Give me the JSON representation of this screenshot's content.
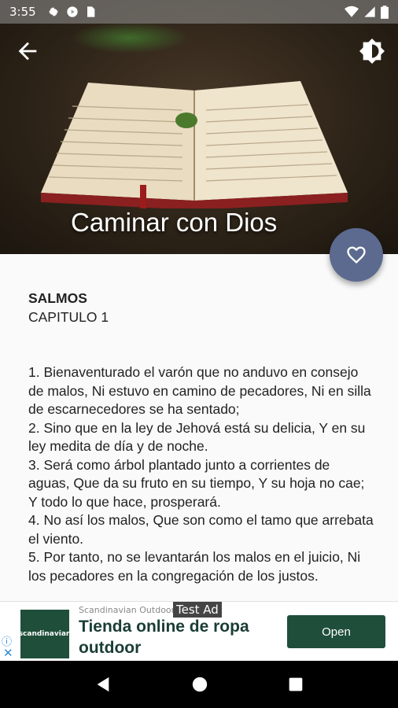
{
  "status_bar": {
    "time": "3:55"
  },
  "header": {
    "title": "Caminar con Dios",
    "back_icon": "arrow-left-icon",
    "theme_icon": "brightness-icon",
    "fab_icon": "heart-outline-icon"
  },
  "content": {
    "book": "SALMOS",
    "chapter": "CAPITULO 1",
    "verses": [
      "1. Bienaventurado el varón que no anduvo en consejo de malos, Ni estuvo en camino de pecadores, Ni en silla de escarnecedores se ha sentado;",
      "2. Sino que en la ley de Jehová está su delicia, Y en su ley medita de día y de noche.",
      "3. Será como árbol plantado junto a corrientes de aguas, Que da su fruto en su tiempo, Y su hoja no cae; Y todo lo que hace, prosperará.",
      "4. No así los malos, Que son como el tamo que arrebata el viento.",
      "5. Por tanto, no se levantarán los malos en el juicio, Ni los pecadores en la congregación de los justos."
    ]
  },
  "ad": {
    "logo_text": "scandinavian",
    "advertiser": "Scandinavian Outdoor",
    "test_label": "Test Ad",
    "title": "Tienda online de ropa outdoor",
    "button": "Open",
    "info_icon": "ⓘ",
    "close_icon": "✕"
  },
  "colors": {
    "fab": "#5c6a8f",
    "ad_accent": "#1f4f3a"
  }
}
